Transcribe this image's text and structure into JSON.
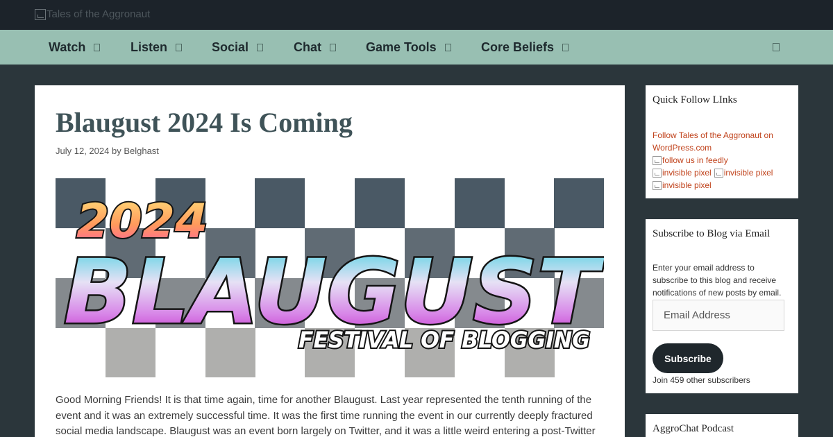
{
  "header": {
    "logo_alt": "Tales of the Aggronaut"
  },
  "nav": {
    "items": [
      {
        "label": "Watch"
      },
      {
        "label": "Listen"
      },
      {
        "label": "Social"
      },
      {
        "label": "Chat"
      },
      {
        "label": "Game Tools"
      },
      {
        "label": "Core Beliefs"
      }
    ]
  },
  "post": {
    "title": "Blaugust 2024 Is Coming",
    "date": "July 12, 2024",
    "by": "by",
    "author": "Belghast",
    "hero": {
      "year": "2024",
      "word": "BLAUGUST",
      "tagline": "FESTIVAL OF BLOGGING"
    },
    "body_lines": [
      "Good Morning Friends! It is that time again, time for another Blaugust. Last year represented the tenth running of the",
      "event and it was an extremely successful time. It was the first time running the event in our currently deeply fractured",
      "social media landscape. Blaugust was an event born largely on Twitter, and it was a little weird entering a post-Twitter"
    ]
  },
  "sidebar": {
    "quick_follow": {
      "title": "Quick Follow LInks",
      "link_line1": "Follow Tales of the Aggronaut on",
      "link_line2": "WordPress.com",
      "feedly_alt": "follow us in feedly",
      "pixel_alt": "invisible pixel"
    },
    "subscribe": {
      "title": "Subscribe to Blog via Email",
      "desc_lines": [
        "Enter your email address to",
        "subscribe to this blog and receive",
        "notifications of new posts by email."
      ],
      "email_placeholder": "Email Address",
      "button_label": "Subscribe",
      "subscriber_note": "Join 459 other subscribers"
    },
    "podcast": {
      "title": "AggroChat Podcast"
    }
  },
  "colors": {
    "topbar": "#1c232a",
    "navbar": "#98bfb2",
    "page_bg": "#2b363b",
    "link": "#c0421b",
    "title": "#3f5358",
    "button": "#1f272c"
  }
}
